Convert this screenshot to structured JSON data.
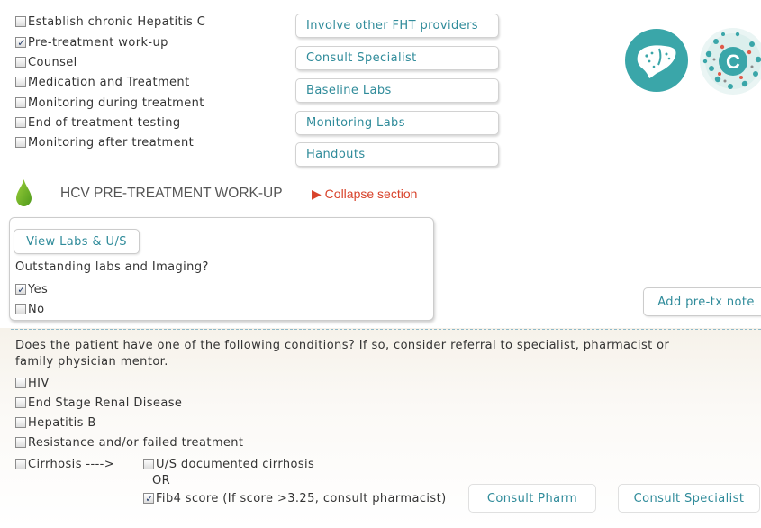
{
  "steps": [
    {
      "label": "Establish chronic Hepatitis C",
      "checked": false
    },
    {
      "label": "Pre-treatment work-up",
      "checked": true
    },
    {
      "label": "Counsel",
      "checked": false
    },
    {
      "label": "Medication and Treatment",
      "checked": false
    },
    {
      "label": "Monitoring during treatment",
      "checked": false
    },
    {
      "label": "End of treatment testing",
      "checked": false
    },
    {
      "label": "Monitoring after treatment",
      "checked": false
    }
  ],
  "actions": [
    "Involve other FHT providers",
    "Consult Specialist",
    "Baseline Labs",
    "Monitoring Labs",
    "Handouts"
  ],
  "logos": {
    "liver_icon": "liver-icon",
    "hep_c_icon": "hepatitis-c-icon",
    "hep_c_letter": "C",
    "color_teal": "#3aa6a9",
    "color_red": "#e05a4a"
  },
  "section": {
    "icon": "green-drop-icon",
    "title": "HCV PRE-TREATMENT WORK-UP",
    "collapse": "Collapse section"
  },
  "labs_panel": {
    "view_button": "View Labs & U/S",
    "question": "Outstanding labs and Imaging?",
    "yes_label": "Yes",
    "yes_checked": true,
    "no_label": "No",
    "no_checked": false
  },
  "add_note_button": "Add pre-tx note",
  "conditions": {
    "prompt_line1": "Does the patient have one of the following conditions? If so, consider referral to specialist, pharmacist or",
    "prompt_line2": "family physician mentor.",
    "items": [
      {
        "label": "HIV",
        "checked": false
      },
      {
        "label": "End Stage Renal Disease",
        "checked": false
      },
      {
        "label": "Hepatitis B",
        "checked": false
      },
      {
        "label": "Resistance and/or failed treatment",
        "checked": false
      }
    ],
    "cirrhosis_label": "Cirrhosis ---->",
    "cirrhosis_checked": false,
    "us_label": "U/S documented cirrhosis",
    "us_checked": false,
    "or_label": "OR",
    "fib4_label": "Fib4 score (If score >3.25, consult pharmacist)",
    "fib4_checked": true,
    "consult_pharm": "Consult Pharm",
    "consult_specialist": "Consult Specialist"
  }
}
